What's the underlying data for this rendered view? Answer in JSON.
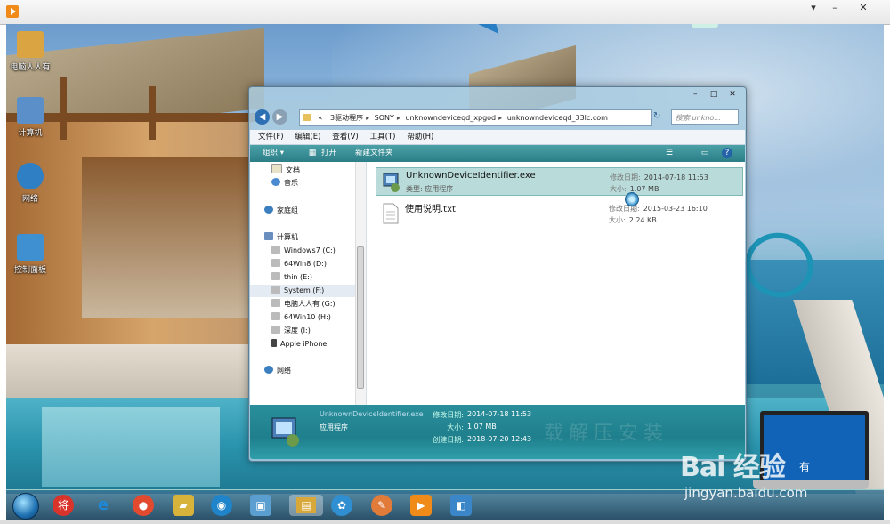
{
  "outer": {
    "controls": [
      "▾",
      "–",
      "✕"
    ]
  },
  "desktop": {
    "icons": [
      {
        "label": "电脑人人有",
        "color": "#d9a441"
      },
      {
        "label": "计算机",
        "color": "#5a8fc9"
      },
      {
        "label": "网络",
        "color": "#2f7fc4"
      },
      {
        "label": "控制面板",
        "color": "#3e90d0"
      }
    ]
  },
  "explorer": {
    "controls": [
      "–",
      "□",
      "✕"
    ],
    "address": {
      "prefix": "«",
      "crumbs": [
        "3驱动程序",
        "SONY",
        "unknowndeviceqd_xpgod",
        "unknowndeviceqd_33lc.com"
      ]
    },
    "search_placeholder": "搜索 unkno...",
    "menu": [
      "文件(F)",
      "编辑(E)",
      "查看(V)",
      "工具(T)",
      "帮助(H)"
    ],
    "toolbar": {
      "organize": "组织 ▾",
      "open": "打开",
      "new_folder": "新建文件夹"
    },
    "nav": [
      {
        "label": "文档",
        "color": "#e8e2c8"
      },
      {
        "label": "音乐",
        "color": "#4a8ad0"
      },
      {
        "label": "家庭组",
        "color": "#3c7fc0"
      },
      {
        "label": "计算机",
        "color": "#6a8fbf"
      },
      {
        "label": "Windows7 (C:)",
        "color": "#bbbbbb"
      },
      {
        "label": "64Win8  (D:)",
        "color": "#bbbbbb"
      },
      {
        "label": "thin (E:)",
        "color": "#bbbbbb"
      },
      {
        "label": "System (F:)",
        "color": "#bbbbbb"
      },
      {
        "label": "电脑人人有 (G:)",
        "color": "#bbbbbb"
      },
      {
        "label": "64Win10 (H:)",
        "color": "#bbbbbb"
      },
      {
        "label": "深度 (I:)",
        "color": "#bbbbbb"
      },
      {
        "label": "Apple iPhone",
        "color": "#444444"
      },
      {
        "label": "网络",
        "color": "#3c7fc0"
      }
    ],
    "files": [
      {
        "name": "UnknownDeviceIdentifier.exe",
        "type_key": "类型:",
        "type": "应用程序",
        "modified_key": "修改日期:",
        "modified": "2014-07-18 11:53",
        "size_key": "大小:",
        "size": "1.07 MB"
      },
      {
        "name": "使用说明.txt",
        "type_key": "",
        "type": "",
        "modified_key": "修改日期:",
        "modified": "2015-03-23 16:10",
        "size_key": "大小:",
        "size": "2.24 KB"
      }
    ],
    "details": {
      "name": "UnknownDeviceIdentifier.exe",
      "type": "应用程序",
      "modified_key": "修改日期:",
      "modified": "2014-07-18 11:53",
      "size_key": "大小:",
      "size": "1.07 MB",
      "created_key": "创建日期:",
      "created": "2018-07-20 12:43",
      "watermark": "载解压安装"
    }
  },
  "taskbar": {
    "apps": [
      {
        "name": "将",
        "color": "#d9342b"
      },
      {
        "name": "e",
        "color": "#1e88d6"
      },
      {
        "name": "●",
        "color": "#e24a2f"
      },
      {
        "name": "▰",
        "color": "#d7b33c"
      },
      {
        "name": "◉",
        "color": "#1f84c9"
      },
      {
        "name": "▣",
        "color": "#5a9fd0"
      },
      {
        "name": "▤",
        "color": "#d8a83a"
      },
      {
        "name": "✿",
        "color": "#2f8fd0"
      },
      {
        "name": "✎",
        "color": "#e07b3a"
      },
      {
        "name": "▶",
        "color": "#f08a18"
      },
      {
        "name": "◧",
        "color": "#3a86c8"
      }
    ]
  },
  "watermark": {
    "brand": "Bai  经验",
    "url": "jingyan.baidu.com",
    "laptop": "有"
  }
}
